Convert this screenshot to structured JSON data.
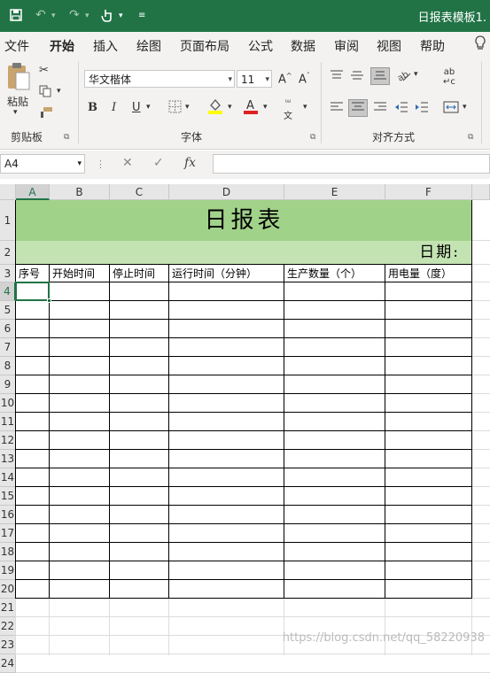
{
  "titlebar": {
    "save_icon": "save-icon",
    "undo_icon": "undo-icon",
    "redo_icon": "redo-icon",
    "touch_icon": "touch-mode-icon",
    "doc_title": "日报表模板1."
  },
  "tabs": [
    "文件",
    "开始",
    "插入",
    "绘图",
    "页面布局",
    "公式",
    "数据",
    "审阅",
    "视图",
    "帮助"
  ],
  "active_tab": "开始",
  "ribbon": {
    "clipboard": {
      "label": "剪贴板",
      "paste": "粘贴"
    },
    "font": {
      "label": "字体",
      "font_name": "华文楷体",
      "font_size": "11"
    },
    "alignment": {
      "label": "对齐方式"
    }
  },
  "formula_bar": {
    "name_box": "A4",
    "fx": "fx",
    "value": ""
  },
  "columns": [
    "A",
    "B",
    "C",
    "D",
    "E",
    "F"
  ],
  "selected_column": "A",
  "rows": [
    "1",
    "2",
    "3",
    "4",
    "5",
    "6",
    "7",
    "8",
    "9",
    "10",
    "11",
    "12",
    "13",
    "14",
    "15",
    "16",
    "17",
    "18",
    "19",
    "20",
    "21",
    "22",
    "23",
    "24"
  ],
  "selected_row": "4",
  "sheet": {
    "title": "日报表",
    "date_label": "日期:",
    "headers": [
      "序号",
      "开始时间",
      "停止时间",
      "运行时间（分钟）",
      "生产数量（个）",
      "用电量（度）"
    ]
  },
  "colors": {
    "excel_green": "#217346",
    "title_fill": "#a1d28a",
    "date_fill": "#c4e3b3"
  },
  "watermark": "https://blog.csdn.net/qq_58220938"
}
